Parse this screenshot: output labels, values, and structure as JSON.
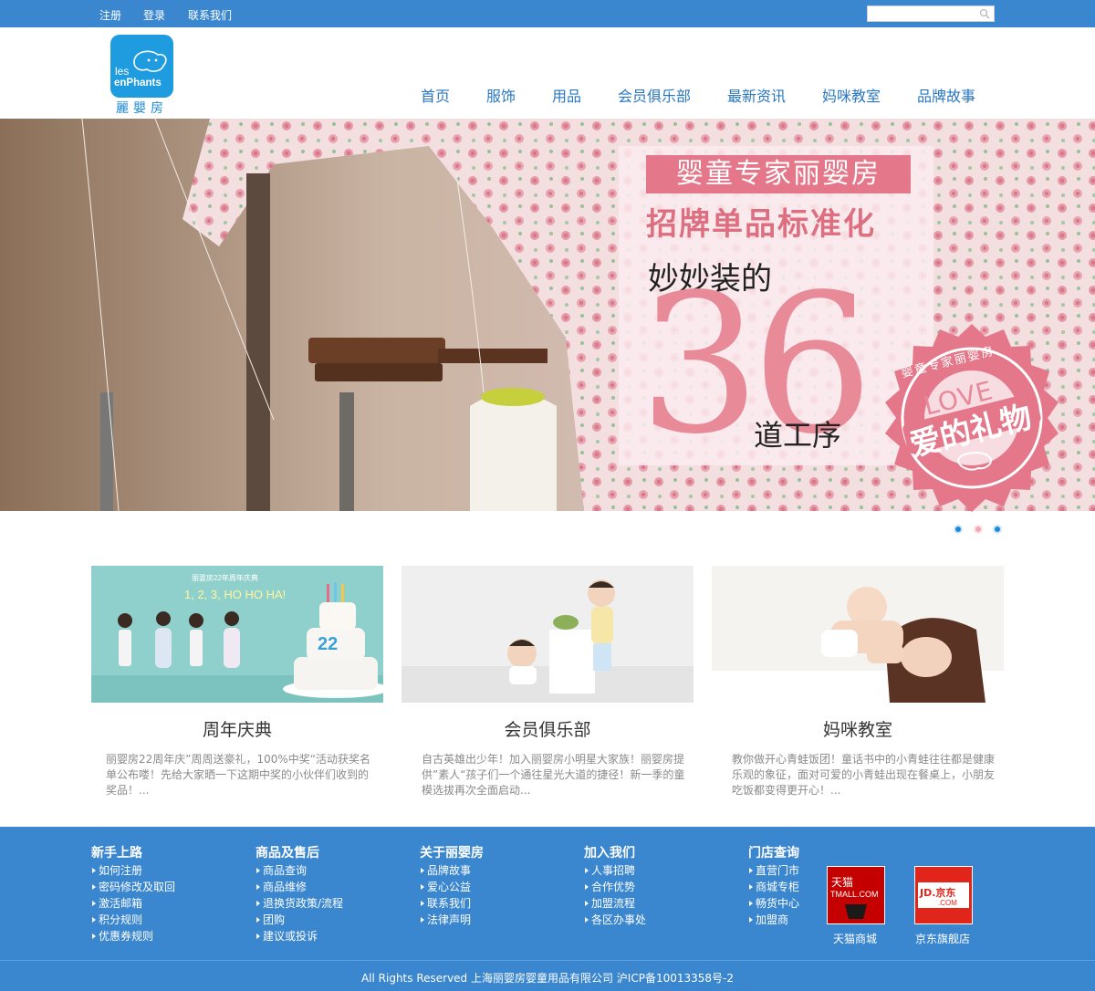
{
  "topbar": {
    "links": [
      "注册",
      "登录",
      "联系我们"
    ],
    "search_placeholder": ""
  },
  "header": {
    "logo_text_line1": "les",
    "logo_text_line2": "enPhants",
    "logo_caption": "麗嬰房",
    "nav": [
      "首页",
      "服饰",
      "用品",
      "会员俱乐部",
      "最新资讯",
      "妈咪教室",
      "品牌故事"
    ]
  },
  "banner": {
    "tag": "婴童专家丽婴房",
    "subtitle": "招牌单品标准化",
    "line1": "妙妙装的",
    "big_number": "36",
    "line2": "道工序",
    "seal_ring": "婴童专家丽婴房",
    "seal_love": "LOVE",
    "seal_gift": "爱的礼物",
    "slides": 3,
    "active_slide": 2
  },
  "cards": [
    {
      "title": "周年庆典",
      "image_caption": "丽婴房22年周年庆典",
      "image_slogan": "1, 2, 3, HO HO HA!",
      "image_cake_number": "22",
      "text": "丽婴房22周年庆”周周送豪礼，100%中奖“活动获奖名单公布喽！先给大家晒一下这期中奖的小伙伴们收到的奖品！..."
    },
    {
      "title": "会员俱乐部",
      "text": "自古英雄出少年！加入丽婴房小明星大家族！丽婴房提供”素人“孩子们一个通往星光大道的捷径！新一季的童模选拔再次全面启动..."
    },
    {
      "title": "妈咪教室",
      "text": "教你做开心青蛙饭团！童话书中的小青蛙往往都是健康乐观的象征，面对可爱的小青蛙出现在餐桌上，小朋友吃饭都变得更开心！..."
    }
  ],
  "footer": {
    "columns": [
      {
        "title": "新手上路",
        "items": [
          "如何注册",
          "密码修改及取回",
          "激活邮箱",
          "积分规则",
          "优惠券规则"
        ]
      },
      {
        "title": "商品及售后",
        "items": [
          "商品查询",
          "商品维修",
          "退换货政策/流程",
          "团购",
          "建议或投诉"
        ]
      },
      {
        "title": "关于丽婴房",
        "items": [
          "品牌故事",
          "爱心公益",
          "联系我们",
          "法律声明"
        ]
      },
      {
        "title": "加入我们",
        "items": [
          "人事招聘",
          "合作优势",
          "加盟流程",
          "各区办事处"
        ]
      },
      {
        "title": "门店查询",
        "items": [
          "直营门市",
          "商城专柜",
          "畅货中心",
          "加盟商"
        ]
      }
    ],
    "shops": [
      {
        "label": "天猫商城",
        "badge_line1": "天猫",
        "badge_line2": "TMALL.COM"
      },
      {
        "label": "京东旗舰店",
        "badge_line1": "JD.京东",
        "badge_line2": ".COM"
      }
    ],
    "copyright": "All Rights Reserved 上海丽婴房婴童用品有限公司  沪ICP备10013358号-2"
  },
  "colors": {
    "primary_blue": "#3a86cf",
    "nav_blue": "#2a77c1",
    "logo_blue": "#1f9ce0",
    "promo_pink": "#e4788a",
    "dot_active": "#f0a9b4",
    "dot_inactive": "#1d8ad6"
  }
}
